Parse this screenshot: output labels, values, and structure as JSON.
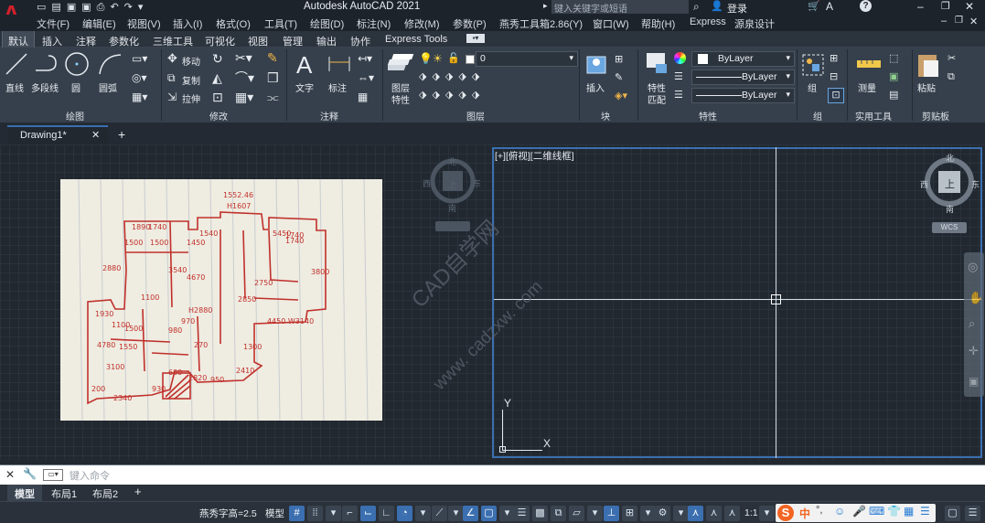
{
  "app": {
    "title": "Autodesk AutoCAD 2021",
    "search_placeholder": "键入关键字或短语",
    "login": "登录"
  },
  "menu": [
    "文件(F)",
    "编辑(E)",
    "视图(V)",
    "插入(I)",
    "格式(O)",
    "工具(T)",
    "绘图(D)",
    "标注(N)",
    "修改(M)",
    "参数(P)",
    "燕秀工具箱2.86(Y)",
    "窗口(W)",
    "帮助(H)",
    "Express",
    "源泉设计"
  ],
  "ribbon_tabs": [
    "默认",
    "插入",
    "注释",
    "参数化",
    "三维工具",
    "可视化",
    "视图",
    "管理",
    "输出",
    "协作",
    "Express Tools"
  ],
  "ribbon": {
    "draw": {
      "line": "直线",
      "polyline": "多段线",
      "circle": "圆",
      "arc": "圆弧",
      "group": "绘图"
    },
    "modify": {
      "move": "移动",
      "copy": "复制",
      "stretch": "拉伸",
      "group": "修改"
    },
    "annotation": {
      "text": "文字",
      "dimension": "标注",
      "group": "注释"
    },
    "layers": {
      "current_layer": "0",
      "properties_line1": "图层",
      "properties_line2": "特性",
      "group": "图层"
    },
    "block": {
      "insert": "插入",
      "group": "块"
    },
    "properties": {
      "match_line1": "特性",
      "match_line2": "匹配",
      "color": "ByLayer",
      "linetype": "ByLayer",
      "lineweight": "ByLayer",
      "group": "特性"
    },
    "groups": {
      "group_btn": "组",
      "group": "组"
    },
    "utilities": {
      "measure": "测量",
      "group": "实用工具"
    },
    "clipboard": {
      "paste": "粘贴",
      "group": "剪贴板"
    }
  },
  "doc_tab": "Drawing1*",
  "viewport": {
    "label": "[+][俯视][二维线框]",
    "viewcube_top": "上",
    "north": "北",
    "south": "南",
    "east": "东",
    "west": "西",
    "wcs": "WCS",
    "axis_x": "X",
    "axis_y": "Y"
  },
  "watermark": {
    "line1": "CAD自学网",
    "line2": "www. cadzxw. com"
  },
  "command": {
    "placeholder": "键入命令"
  },
  "layout_tabs": [
    "模型",
    "布局1",
    "布局2"
  ],
  "status": {
    "font_text": "燕秀字高=2.5",
    "model": "模型",
    "scale": "1:1",
    "ime": "中"
  },
  "colors": {
    "accent": "#3b6fb0",
    "sketch_red": "#c0302b",
    "paper": "#efece1"
  }
}
